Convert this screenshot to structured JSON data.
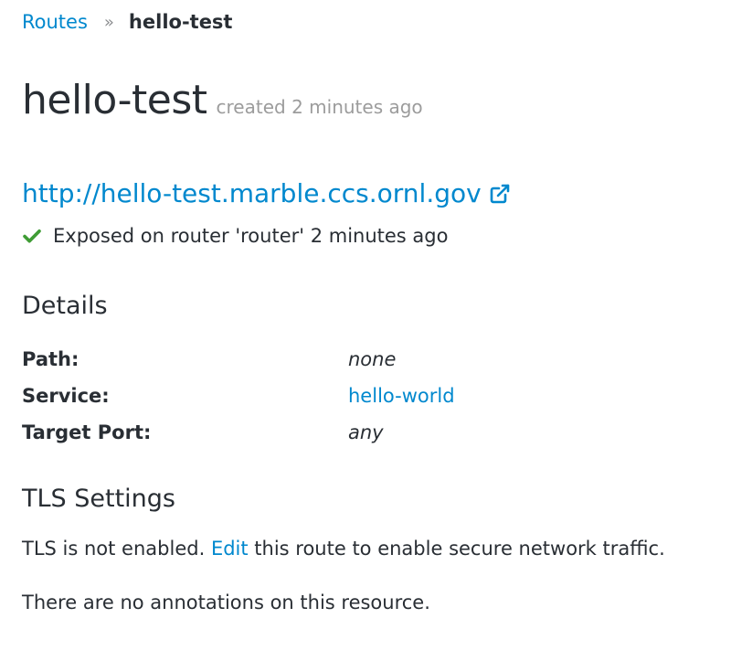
{
  "breadcrumb": {
    "parent": "Routes",
    "separator": "»",
    "current": "hello-test"
  },
  "header": {
    "title": "hello-test",
    "created": "created 2 minutes ago"
  },
  "route": {
    "url": "http://hello-test.marble.ccs.ornl.gov",
    "status": "Exposed on router 'router' 2 minutes ago"
  },
  "details": {
    "heading": "Details",
    "rows": [
      {
        "key": "Path:",
        "value": "none"
      },
      {
        "key": "Service:",
        "value": "hello-world"
      },
      {
        "key": "Target Port:",
        "value": "any"
      }
    ]
  },
  "tls": {
    "heading": "TLS Settings",
    "text_before": "TLS is not enabled.",
    "edit_link": "Edit",
    "text_after": "this route to enable secure network traffic."
  },
  "annotations": {
    "text": "There are no annotations on this resource."
  },
  "colors": {
    "link": "#0088ce",
    "text": "#292e34",
    "muted": "#9c9c9c",
    "success": "#3f9c35"
  },
  "icons": {
    "external_link": "external-link-icon",
    "status": "check-icon"
  }
}
